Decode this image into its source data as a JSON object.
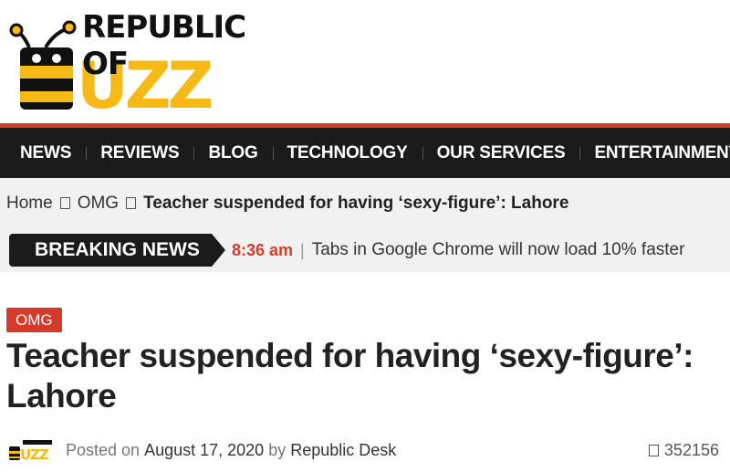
{
  "logo": {
    "line1": "REPUBLIC OF",
    "line2": "BUZZ"
  },
  "nav": {
    "items": [
      "NEWS",
      "REVIEWS",
      "BLOG",
      "TECHNOLOGY",
      "OUR SERVICES",
      "ENTERTAINMENT"
    ]
  },
  "breadcrumb": {
    "home": "Home",
    "category": "OMG",
    "current": "Teacher suspended for having ‘sexy-figure’: Lahore"
  },
  "breaking_news": {
    "label": "BREAKING NEWS",
    "time": "8:36 am",
    "separator": "|",
    "headline": "Tabs in Google Chrome will now load 10% faster"
  },
  "article": {
    "category": "OMG",
    "title": "Teacher suspended for having ‘sexy-figure’: Lahore",
    "meta": {
      "posted_on_label": "Posted on",
      "date": "August 17, 2020",
      "by_label": "by",
      "author": "Republic Desk",
      "views": "352156"
    }
  },
  "colors": {
    "accent": "#d63a2a",
    "nav_bg": "#1b1b1b",
    "logo_yellow": "#f7b916",
    "bar_bg": "#f1f1f1"
  }
}
